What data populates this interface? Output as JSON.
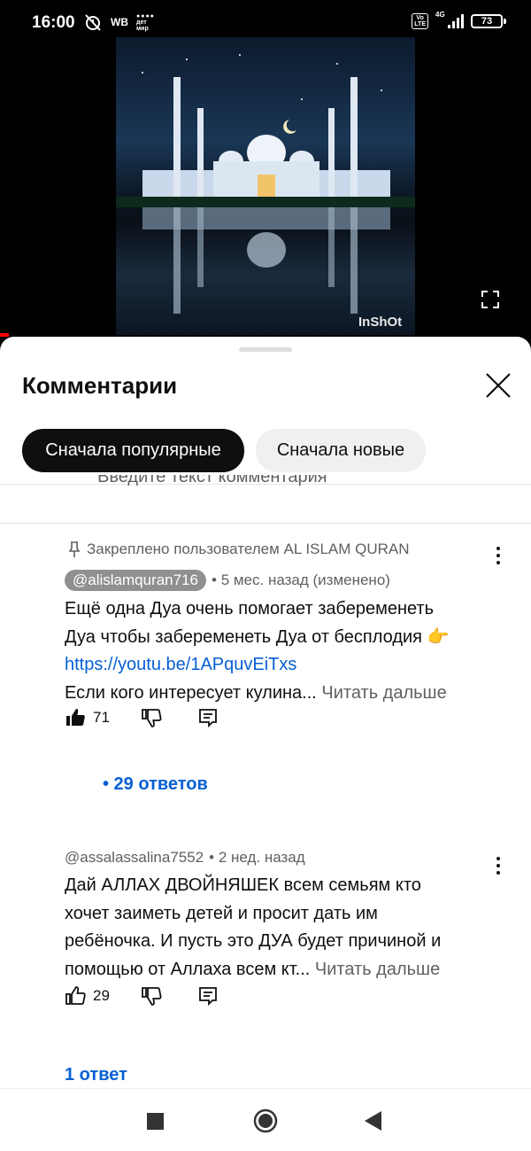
{
  "status_bar": {
    "time": "16:00",
    "wb": "WB",
    "detmir_line1": "дет",
    "detmir_line2": "мир",
    "volte_line1": "Vo",
    "volte_line2": "LTE",
    "network": "4G",
    "battery": "73"
  },
  "video": {
    "watermark": "InShOt"
  },
  "comments_panel": {
    "title": "Комментарии",
    "filters": [
      "Сначала популярные",
      "Сначала новые"
    ],
    "input_placeholder": "Введите текст комментария"
  },
  "comments": [
    {
      "pinned_label": "Закреплено пользователем AL ISLAM QURAN",
      "author": "@alislamquran716",
      "time": "• 5 мес. назад (изменено)",
      "text_line1": "Ещё одна Дуа очень помогает забеременеть",
      "text_line2": "Дуа чтобы забеременеть Дуа от бесплодия 👉",
      "link": "https://youtu.be/1APquvEiTxs",
      "text_line4": "Если кого интересует кулина...",
      "read_more": "Читать дальше",
      "likes": "71",
      "replies": "• 29 ответов"
    },
    {
      "author": "@assalassalina7552",
      "time": "• 2 нед. назад",
      "text_line1": "Дай АЛЛАХ ДВОЙНЯШЕК  всем семьям кто",
      "text_line2": "хочет заиметь детей и просит дать им",
      "text_line3": "ребёночка. И пусть это ДУА будет причиной и",
      "text_line4": "помощью от Аллаха всем кт...",
      "read_more": "Читать дальше",
      "likes": "29",
      "replies": "1 ответ"
    }
  ]
}
